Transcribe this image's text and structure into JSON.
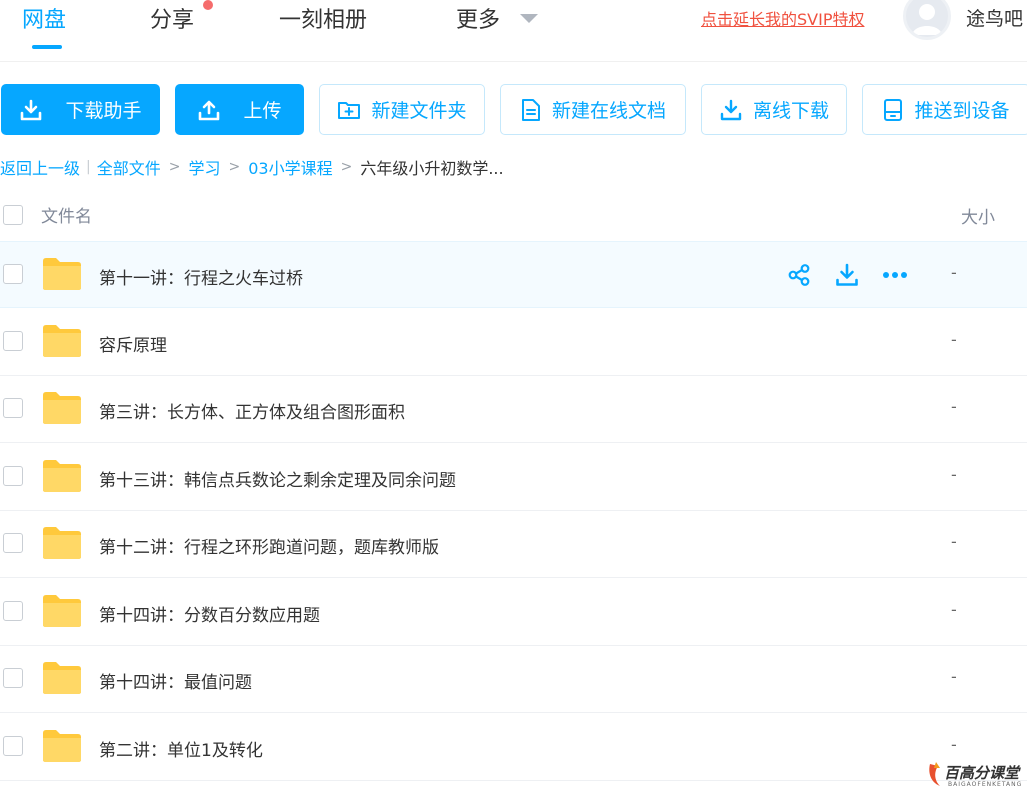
{
  "nav": {
    "tabs": [
      {
        "label": "网盘",
        "active": true
      },
      {
        "label": "分享",
        "badge": "red-dot"
      },
      {
        "label": "一刻相册"
      },
      {
        "label": "更多"
      }
    ],
    "svip_link": "点击延长我的SVIP特权",
    "user_name": "途鸟吧"
  },
  "toolbar": {
    "download_helper": "下载助手",
    "upload": "上传",
    "new_folder": "新建文件夹",
    "new_online_doc": "新建在线文档",
    "offline_download": "离线下载",
    "push_to_device": "推送到设备"
  },
  "breadcrumb": {
    "back": "返回上一级",
    "separator_bar": "|",
    "separator": ">",
    "items": [
      "全部文件",
      "学习",
      "03小学课程"
    ],
    "current": "六年级小升初数学..."
  },
  "table": {
    "columns": {
      "name": "文件名",
      "size": "大小"
    },
    "rows": [
      {
        "name": "第十一讲：行程之火车过桥",
        "size": "-",
        "hovered": true
      },
      {
        "name": "容斥原理",
        "size": "-"
      },
      {
        "name": "第三讲：长方体、正方体及组合图形面积",
        "size": "-"
      },
      {
        "name": "第十三讲：韩信点兵数论之剩余定理及同余问题",
        "size": "-"
      },
      {
        "name": "第十二讲：行程之环形跑道问题，题库教师版",
        "size": "-"
      },
      {
        "name": "第十四讲：分数百分数应用题",
        "size": "-"
      },
      {
        "name": "第十四讲：最值问题",
        "size": "-"
      },
      {
        "name": "第二讲：单位1及转化",
        "size": "-"
      }
    ],
    "row_actions": [
      "share-icon",
      "download-icon",
      "more-icon"
    ]
  },
  "watermark": {
    "text": "百高分课堂",
    "sub": "BAIGAOFENKETANG"
  },
  "colors": {
    "accent": "#06a7ff",
    "svip": "#f0513f",
    "folder": "#ffd15c",
    "badge": "#f56c6c"
  }
}
